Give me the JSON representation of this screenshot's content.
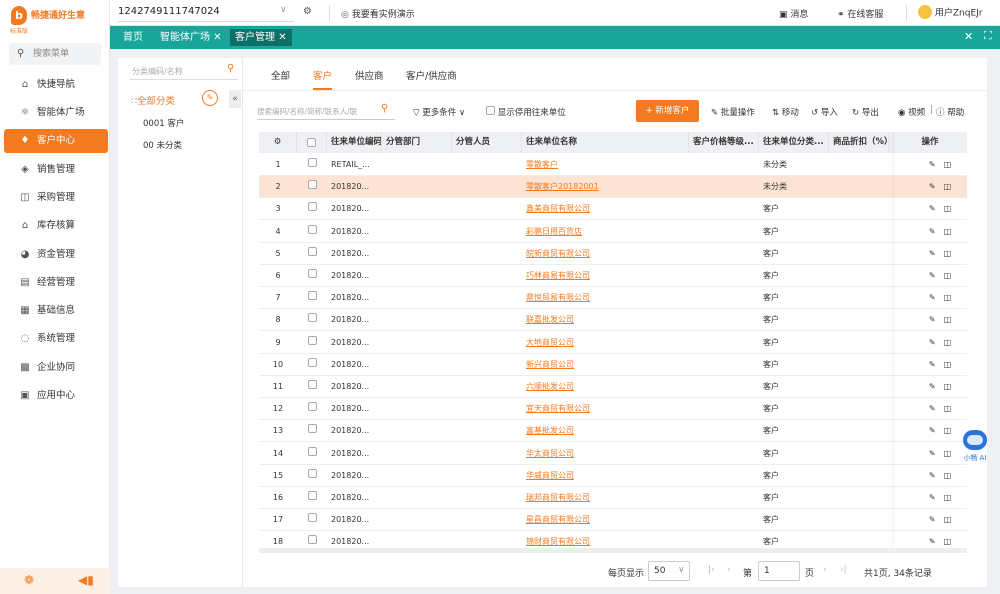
{
  "brand": {
    "name": "畅捷通好生意",
    "edition": "标准版",
    "logo_letter": "b",
    "accent": "#f47a20",
    "tab_color": "#18a59a"
  },
  "sidebar": {
    "search_placeholder": "搜索菜单",
    "items": [
      {
        "label": "快捷导航",
        "icon": "home-icon"
      },
      {
        "label": "智能体广场",
        "icon": "ai-icon"
      },
      {
        "label": "客户中心",
        "icon": "diamond-icon"
      },
      {
        "label": "销售管理",
        "icon": "tag-icon"
      },
      {
        "label": "采购管理",
        "icon": "bag-icon"
      },
      {
        "label": "库存核算",
        "icon": "warehouse-icon"
      },
      {
        "label": "资金管理",
        "icon": "money-icon"
      },
      {
        "label": "经营管理",
        "icon": "clipboard-icon"
      },
      {
        "label": "基础信息",
        "icon": "info-card-icon"
      },
      {
        "label": "系统管理",
        "icon": "dashed-circle-icon"
      },
      {
        "label": "企业协同",
        "icon": "cooperation-icon"
      },
      {
        "label": "应用中心",
        "icon": "app-icon"
      }
    ]
  },
  "topbar": {
    "account_id": "1242749111747024",
    "demo_link": "我要看实例演示",
    "messages": "消息",
    "service": "在线客服",
    "user": "用户ZnqEJr"
  },
  "tabs": [
    {
      "label": "首页"
    },
    {
      "label": "智能体广场"
    },
    {
      "label": "客户管理"
    }
  ],
  "tree": {
    "search_placeholder": "分类编码/名称",
    "root": "全部分类",
    "nodes": [
      "0001 客户",
      "00 未分类"
    ]
  },
  "main": {
    "type_tabs": [
      "全部",
      "客户",
      "供应商",
      "客户/供应商"
    ],
    "search_placeholder": "搜索编码/名称/简称/联系人/联",
    "more_conditions": "更多条件",
    "show_disabled": "显示停用往来单位",
    "new_button": "+ 新增客户",
    "toolbar": [
      "批量操作",
      "移动",
      "导入",
      "导出",
      "视频",
      "帮助"
    ]
  },
  "table": {
    "columns": [
      "往来单位编码",
      "分管部门",
      "分管人员",
      "往来单位名称",
      "客户价格等级...",
      "往来单位分类...",
      "商品折扣（%）",
      "操作"
    ],
    "rows": [
      {
        "no": "1",
        "code": "RETAIL_...",
        "name": "零散客户",
        "category": "未分类"
      },
      {
        "no": "2",
        "code": "201820...",
        "name": "零散客户20182001",
        "category": "未分类"
      },
      {
        "no": "3",
        "code": "201820...",
        "name": "鑫美商贸有限公司",
        "category": "客户"
      },
      {
        "no": "4",
        "code": "201820...",
        "name": "彩鹏日用百货店",
        "category": "客户"
      },
      {
        "no": "5",
        "code": "201820...",
        "name": "皖新商贸有限公司",
        "category": "客户"
      },
      {
        "no": "6",
        "code": "201820...",
        "name": "巧林商易有限公司",
        "category": "客户"
      },
      {
        "no": "7",
        "code": "201820...",
        "name": "鼎悦贸易有限公司",
        "category": "客户"
      },
      {
        "no": "8",
        "code": "201820...",
        "name": "联嘉批发公司",
        "category": "客户"
      },
      {
        "no": "9",
        "code": "201820...",
        "name": "大地商贸公司",
        "category": "客户"
      },
      {
        "no": "10",
        "code": "201820...",
        "name": "新兴商贸公司",
        "category": "客户"
      },
      {
        "no": "11",
        "code": "201820...",
        "name": "六顺批发公司",
        "category": "客户"
      },
      {
        "no": "12",
        "code": "201820...",
        "name": "宜天商贸有限公司",
        "category": "客户"
      },
      {
        "no": "13",
        "code": "201820...",
        "name": "富基批发公司",
        "category": "客户"
      },
      {
        "no": "14",
        "code": "201820...",
        "name": "华太商贸公司",
        "category": "客户"
      },
      {
        "no": "15",
        "code": "201820...",
        "name": "华威商贸公司",
        "category": "客户"
      },
      {
        "no": "16",
        "code": "201820...",
        "name": "瑞邦商贸有限公司",
        "category": "客户"
      },
      {
        "no": "17",
        "code": "201820...",
        "name": "星昌商贸有限公司",
        "category": "客户"
      },
      {
        "no": "18",
        "code": "201820...",
        "name": "锦财商贸有限公司",
        "category": "客户"
      }
    ]
  },
  "pager": {
    "per_page_label": "每页显示",
    "per_page": "50",
    "page_prefix": "第",
    "page": "1",
    "page_suffix": "页",
    "summary": "共1页, 34条记录"
  },
  "assistant": {
    "label": "小畅 AI"
  }
}
